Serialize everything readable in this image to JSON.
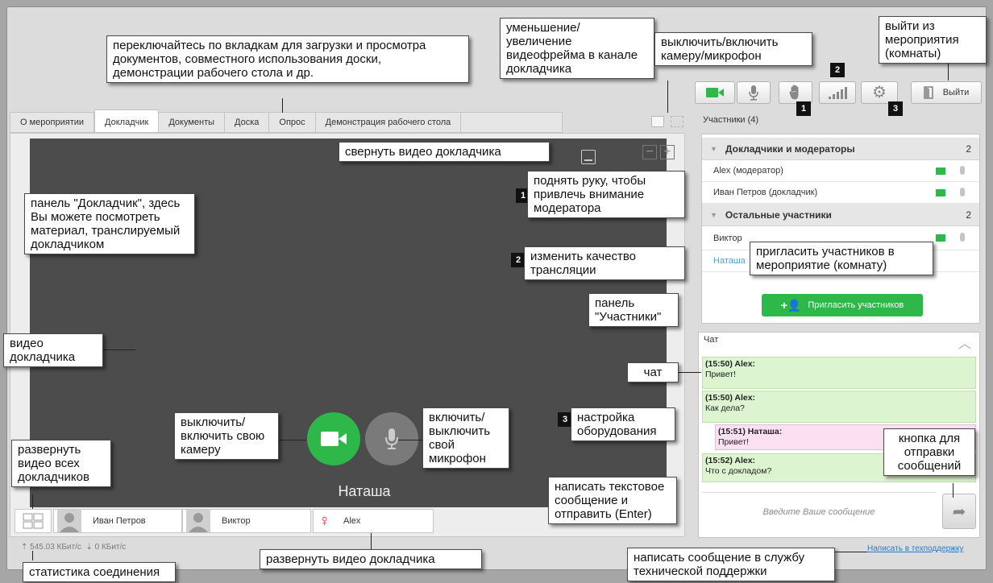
{
  "colors": {
    "accent_green": "#2eb84a",
    "video_bg": "#4c4c4c",
    "chat_green": "#dcf5d0",
    "chat_pink": "#fbe0f2"
  },
  "tabs": [
    "О мероприятии",
    "Докладчик",
    "Документы",
    "Доска",
    "Опрос",
    "Демонстрация рабочего стола"
  ],
  "toolbar": {
    "exit_label": "Выйти",
    "badge_1": "1",
    "badge_2": "2",
    "badge_3": "3"
  },
  "participants": {
    "title": "Участники (4)",
    "groups": [
      {
        "name": "Докладчики и модераторы",
        "count": "2",
        "members": [
          "Alex (модератор)",
          "Иван Петров (докладчик)"
        ]
      },
      {
        "name": "Остальные участники",
        "count": "2",
        "members": [
          "Виктор",
          "Наташа"
        ]
      }
    ],
    "invite_label": "Пригласить участников"
  },
  "chat": {
    "title": "Чат",
    "messages": [
      {
        "head": "(15:50) Alex:",
        "text": "Привет!"
      },
      {
        "head": "(15:50) Alex:",
        "text": "Как дела?"
      },
      {
        "head": "(15:51) Наташа:",
        "text": "Привет!"
      },
      {
        "head": "(15:52) Alex:",
        "text": "Что с докладом?"
      }
    ],
    "placeholder": "Введите Ваше сообщение"
  },
  "video": {
    "speaker_name": "Наташа"
  },
  "thumbs": [
    "Иван Петров",
    "Виктор",
    "Alex"
  ],
  "stats": {
    "up": "545.03 КБит/с",
    "down": "0 КБит/с"
  },
  "support_link": "Написать в техподдержку",
  "annotations": {
    "tabs_hint": "переключайтесь по вкладкам для загрузки и просмотра документов, совместного использования доски, демонстрации рабочего стола и др.",
    "zoom_hint": "уменьшение/ увеличение видеофрейма в канале докладчика",
    "cam_mic_hint": "выключить/включить камеру/микрофон",
    "exit_hint": "выйти из мероприятия (комнаты)",
    "collapse_video": "свернуть видео докладчика",
    "raise_hand": "поднять руку, чтобы привлечь внимание модератора",
    "quality": "изменить качество трансляции",
    "presenter_panel": "панель \"Докладчик\", здесь Вы можете посмотреть материал, транслируемый докладчиком",
    "invite_hint": "пригласить участников в мероприятие (комнату)",
    "participants_panel": "панель \"Участники\"",
    "presenter_video": "видео докладчика",
    "chat": "чат",
    "settings": "настройка оборудования",
    "own_camera": "выключить/ включить свою камеру",
    "own_mic": "включить/ выключить свой микрофон",
    "send_button": "кнопка для отправки сообщений",
    "expand_all": "развернуть видео всех докладчиков",
    "write_message": "написать текстовое сообщение и отправить (Enter)",
    "expand_presenter": "развернуть видео докладчика",
    "support": "написать сообщение в службу технической поддержки",
    "stats": "статистика соединения"
  }
}
